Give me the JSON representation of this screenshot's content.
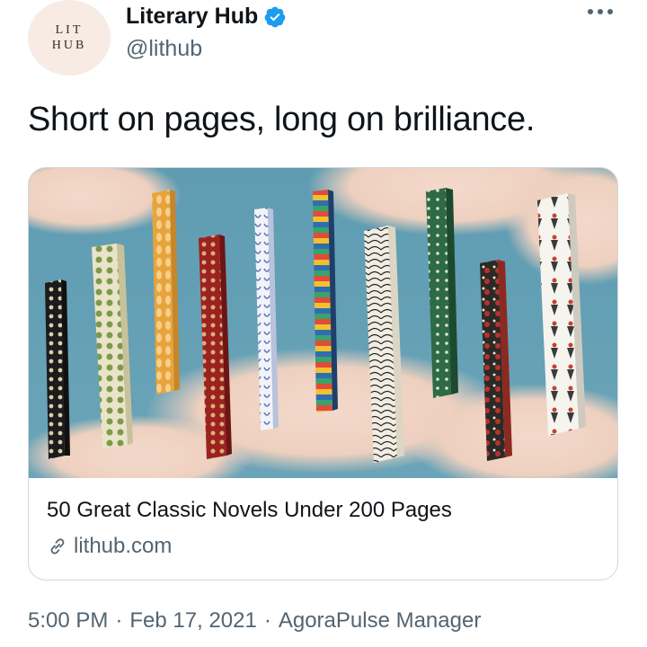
{
  "author": {
    "avatar_line1": "LIT",
    "avatar_line2": "HUB",
    "display_name": "Literary Hub",
    "handle": "@lithub"
  },
  "tweet": {
    "text": "Short on pages, long on brilliance."
  },
  "card": {
    "title": "50 Great Classic Novels Under 200 Pages",
    "domain": "lithub.com"
  },
  "meta": {
    "time": "5:00 PM",
    "separator1": "·",
    "date": "Feb 17, 2021",
    "separator2": "·",
    "source": "AgoraPulse Manager"
  },
  "icons": {
    "verified": "verified-badge-icon",
    "more": "more-options-icon",
    "link": "link-icon"
  },
  "colors": {
    "verified_blue": "#1d9bf0",
    "secondary_text": "#536471",
    "primary_text": "#0f1419",
    "border": "#cfd9de"
  }
}
